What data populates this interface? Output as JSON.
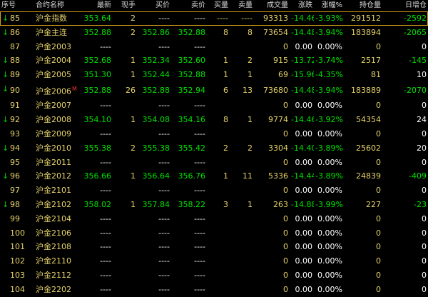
{
  "columns": [
    "序号",
    "合约名称",
    "最新",
    "现手",
    "买价",
    "卖价",
    "买量",
    "卖量",
    "成交量",
    "涨跌",
    "涨幅%",
    "持仓量",
    "日增仓"
  ],
  "colors": {
    "background": "#000000",
    "up": "#ff3030",
    "down": "#00e000",
    "name": "#e6d36a",
    "neutral": "#ffffff",
    "selection": "#d4a017"
  },
  "rows": [
    {
      "seq": "85",
      "arrow": "↓",
      "name": "沪金指数",
      "flag": "",
      "latest": "353.64",
      "vol": "2",
      "bid": "----",
      "ask": "----",
      "bidq": "----",
      "askq": "----",
      "volume": "93313",
      "chg": "-14.46",
      "pct": "-3.93%",
      "oi": "291512",
      "oichg": "-2592",
      "selected": true
    },
    {
      "seq": "86",
      "arrow": "↓",
      "name": "沪金主连",
      "flag": "",
      "latest": "352.88",
      "vol": "2",
      "bid": "352.86",
      "ask": "352.88",
      "bidq": "8",
      "askq": "8",
      "volume": "73654",
      "chg": "-14.48",
      "pct": "-3.94%",
      "oi": "183894",
      "oichg": "-2065"
    },
    {
      "seq": "87",
      "arrow": "",
      "name": "沪金2003",
      "flag": "",
      "latest": "----",
      "vol": "",
      "bid": "----",
      "ask": "----",
      "bidq": "",
      "askq": "",
      "volume": "0",
      "chg": "0.00",
      "pct": "0.00%",
      "oi": "0",
      "oichg": "0"
    },
    {
      "seq": "88",
      "arrow": "↓",
      "name": "沪金2004",
      "flag": "",
      "latest": "352.68",
      "vol": "1",
      "bid": "352.34",
      "ask": "352.60",
      "bidq": "1",
      "askq": "2",
      "volume": "915",
      "chg": "-13.72",
      "pct": "-3.74%",
      "oi": "2517",
      "oichg": "-145"
    },
    {
      "seq": "89",
      "arrow": "↓",
      "name": "沪金2005",
      "flag": "",
      "latest": "351.30",
      "vol": "1",
      "bid": "352.44",
      "ask": "352.88",
      "bidq": "1",
      "askq": "1",
      "volume": "69",
      "chg": "-15.96",
      "pct": "-4.35%",
      "oi": "81",
      "oichg": "10"
    },
    {
      "seq": "90",
      "arrow": "↓",
      "name": "沪金2006",
      "flag": "M",
      "latest": "352.88",
      "vol": "26",
      "bid": "352.88",
      "ask": "352.94",
      "bidq": "6",
      "askq": "13",
      "volume": "73680",
      "chg": "-14.48",
      "pct": "-3.94%",
      "oi": "183889",
      "oichg": "-2070"
    },
    {
      "seq": "91",
      "arrow": "",
      "name": "沪金2007",
      "flag": "",
      "latest": "----",
      "vol": "",
      "bid": "----",
      "ask": "----",
      "bidq": "",
      "askq": "",
      "volume": "0",
      "chg": "0.00",
      "pct": "0.00%",
      "oi": "0",
      "oichg": "0"
    },
    {
      "seq": "92",
      "arrow": "↓",
      "name": "沪金2008",
      "flag": "",
      "latest": "354.10",
      "vol": "1",
      "bid": "354.08",
      "ask": "354.16",
      "bidq": "8",
      "askq": "1",
      "volume": "9774",
      "chg": "-14.46",
      "pct": "-3.92%",
      "oi": "54354",
      "oichg": "24"
    },
    {
      "seq": "93",
      "arrow": "",
      "name": "沪金2009",
      "flag": "",
      "latest": "----",
      "vol": "",
      "bid": "----",
      "ask": "----",
      "bidq": "",
      "askq": "",
      "volume": "0",
      "chg": "0.00",
      "pct": "0.00%",
      "oi": "0",
      "oichg": "0"
    },
    {
      "seq": "94",
      "arrow": "↓",
      "name": "沪金2010",
      "flag": "",
      "latest": "355.38",
      "vol": "2",
      "bid": "355.38",
      "ask": "355.42",
      "bidq": "2",
      "askq": "2",
      "volume": "3304",
      "chg": "-14.40",
      "pct": "-3.89%",
      "oi": "25602",
      "oichg": "20"
    },
    {
      "seq": "95",
      "arrow": "",
      "name": "沪金2011",
      "flag": "",
      "latest": "----",
      "vol": "",
      "bid": "----",
      "ask": "----",
      "bidq": "",
      "askq": "",
      "volume": "0",
      "chg": "0.00",
      "pct": "0.00%",
      "oi": "0",
      "oichg": "0"
    },
    {
      "seq": "96",
      "arrow": "↓",
      "name": "沪金2012",
      "flag": "",
      "latest": "356.66",
      "vol": "1",
      "bid": "356.64",
      "ask": "356.76",
      "bidq": "1",
      "askq": "11",
      "volume": "5336",
      "chg": "-14.44",
      "pct": "-3.89%",
      "oi": "24839",
      "oichg": "-409"
    },
    {
      "seq": "97",
      "arrow": "",
      "name": "沪金2101",
      "flag": "",
      "latest": "----",
      "vol": "",
      "bid": "----",
      "ask": "----",
      "bidq": "",
      "askq": "",
      "volume": "0",
      "chg": "0.00",
      "pct": "0.00%",
      "oi": "0",
      "oichg": "0"
    },
    {
      "seq": "98",
      "arrow": "↓",
      "name": "沪金2102",
      "flag": "",
      "latest": "358.02",
      "vol": "1",
      "bid": "357.84",
      "ask": "358.22",
      "bidq": "3",
      "askq": "1",
      "volume": "263",
      "chg": "-14.88",
      "pct": "-3.99%",
      "oi": "227",
      "oichg": "-23"
    },
    {
      "seq": "99",
      "arrow": "",
      "name": "沪金2104",
      "flag": "",
      "latest": "----",
      "vol": "",
      "bid": "----",
      "ask": "----",
      "bidq": "",
      "askq": "",
      "volume": "0",
      "chg": "0.00",
      "pct": "0.00%",
      "oi": "0",
      "oichg": "0"
    },
    {
      "seq": "100",
      "arrow": "",
      "name": "沪金2106",
      "flag": "",
      "latest": "----",
      "vol": "",
      "bid": "----",
      "ask": "----",
      "bidq": "",
      "askq": "",
      "volume": "0",
      "chg": "0.00",
      "pct": "0.00%",
      "oi": "0",
      "oichg": "0"
    },
    {
      "seq": "101",
      "arrow": "",
      "name": "沪金2108",
      "flag": "",
      "latest": "----",
      "vol": "",
      "bid": "----",
      "ask": "----",
      "bidq": "",
      "askq": "",
      "volume": "0",
      "chg": "0.00",
      "pct": "0.00%",
      "oi": "0",
      "oichg": "0"
    },
    {
      "seq": "102",
      "arrow": "",
      "name": "沪金2110",
      "flag": "",
      "latest": "----",
      "vol": "",
      "bid": "----",
      "ask": "----",
      "bidq": "",
      "askq": "",
      "volume": "0",
      "chg": "0.00",
      "pct": "0.00%",
      "oi": "0",
      "oichg": "0"
    },
    {
      "seq": "103",
      "arrow": "",
      "name": "沪金2112",
      "flag": "",
      "latest": "----",
      "vol": "",
      "bid": "----",
      "ask": "----",
      "bidq": "",
      "askq": "",
      "volume": "0",
      "chg": "0.00",
      "pct": "0.00%",
      "oi": "0",
      "oichg": "0"
    },
    {
      "seq": "104",
      "arrow": "",
      "name": "沪金2202",
      "flag": "",
      "latest": "----",
      "vol": "",
      "bid": "----",
      "ask": "----",
      "bidq": "",
      "askq": "",
      "volume": "0",
      "chg": "0.00",
      "pct": "0.00%",
      "oi": "0",
      "oichg": "0"
    }
  ]
}
